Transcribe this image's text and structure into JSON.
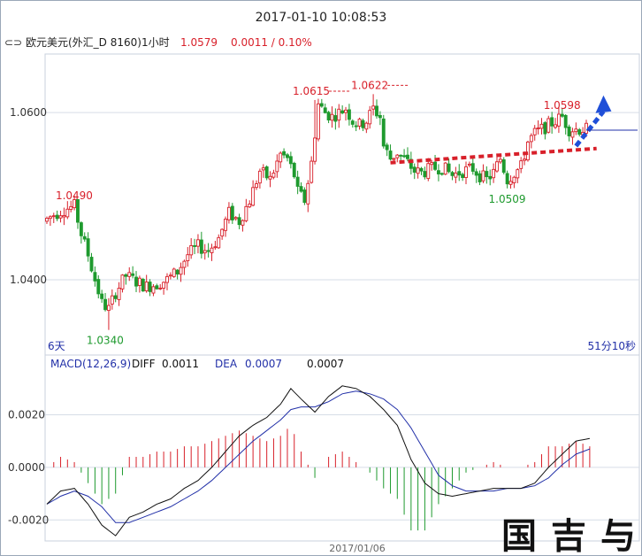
{
  "window": {
    "timestamp": "2017-01-10 10:08:53"
  },
  "header": {
    "icon": "chart-link-icon",
    "symbol": "欧元美元(外汇_D 8160)1小时",
    "last": "1.0579",
    "change": "0.0011 / 0.10%"
  },
  "price_panel": {
    "left_note": "6天",
    "right_note": "51分10秒"
  },
  "macd_panel": {
    "title": "MACD(12,26,9)",
    "diff_label": "DIFF",
    "diff_value": "0.0011",
    "dea_label": "DEA",
    "dea_value": "0.0007",
    "macd_value": "0.0007"
  },
  "x_axis": {
    "date_label": "2017/01/06"
  },
  "signature": "国吉与",
  "colors": {
    "up": "#d8202a",
    "down": "#1e9a2e",
    "dea": "#2230a8",
    "diff": "#111111",
    "arrow": "#1f4fd8",
    "trend": "#d8202a"
  },
  "chart_data": [
    {
      "type": "candlestick",
      "title": "欧元美元 1小时",
      "ylim": [
        1.031,
        1.067
      ],
      "y_ticks": [
        1.04,
        1.06
      ],
      "y_tick_labels": [
        "1.0400",
        "1.0600"
      ],
      "annotations": [
        {
          "text": "1.0490",
          "bar": 9,
          "price": 1.049,
          "kind": "high"
        },
        {
          "text": "1.0340",
          "bar": 18,
          "price": 1.034,
          "kind": "low"
        },
        {
          "text": "1.0615",
          "bar": 78,
          "price": 1.0615,
          "kind": "high"
        },
        {
          "text": "1.0622",
          "bar": 95,
          "price": 1.0622,
          "kind": "high"
        },
        {
          "text": "1.0509",
          "bar": 135,
          "price": 1.0509,
          "kind": "low"
        },
        {
          "text": "1.0598",
          "bar": 151,
          "price": 1.0598,
          "kind": "high"
        }
      ],
      "guide_points": [
        [
          0,
          1.047
        ],
        [
          3,
          1.0478
        ],
        [
          6,
          1.0484
        ],
        [
          9,
          1.0488
        ],
        [
          11,
          1.0455
        ],
        [
          13,
          1.043
        ],
        [
          15,
          1.04
        ],
        [
          17,
          1.0372
        ],
        [
          19,
          1.0365
        ],
        [
          21,
          1.0385
        ],
        [
          24,
          1.0405
        ],
        [
          27,
          1.0398
        ],
        [
          30,
          1.0392
        ],
        [
          33,
          1.0395
        ],
        [
          36,
          1.04
        ],
        [
          39,
          1.041
        ],
        [
          42,
          1.043
        ],
        [
          45,
          1.044
        ],
        [
          48,
          1.0435
        ],
        [
          51,
          1.045
        ],
        [
          54,
          1.048
        ],
        [
          57,
          1.047
        ],
        [
          60,
          1.0495
        ],
        [
          63,
          1.053
        ],
        [
          66,
          1.052
        ],
        [
          69,
          1.055
        ],
        [
          71,
          1.0545
        ],
        [
          73,
          1.0525
        ],
        [
          74,
          1.0505
        ],
        [
          76,
          1.0495
        ],
        [
          78,
          1.054
        ],
        [
          80,
          1.061
        ],
        [
          82,
          1.06
        ],
        [
          84,
          1.0595
        ],
        [
          86,
          1.06
        ],
        [
          88,
          1.0605
        ],
        [
          90,
          1.059
        ],
        [
          92,
          1.0585
        ],
        [
          94,
          1.059
        ],
        [
          96,
          1.0605
        ],
        [
          98,
          1.0595
        ],
        [
          99,
          1.056
        ],
        [
          101,
          1.0545
        ],
        [
          103,
          1.0552
        ],
        [
          106,
          1.054
        ],
        [
          108,
          1.053
        ],
        [
          110,
          1.0528
        ],
        [
          113,
          1.0533
        ],
        [
          116,
          1.0535
        ],
        [
          119,
          1.0525
        ],
        [
          122,
          1.053
        ],
        [
          125,
          1.0533
        ],
        [
          127,
          1.0525
        ],
        [
          129,
          1.052
        ],
        [
          131,
          1.0528
        ],
        [
          133,
          1.0545
        ],
        [
          135,
          1.052
        ],
        [
          137,
          1.0528
        ],
        [
          139,
          1.0535
        ],
        [
          141,
          1.0565
        ],
        [
          143,
          1.0575
        ],
        [
          145,
          1.058
        ],
        [
          147,
          1.0585
        ],
        [
          149,
          1.059
        ],
        [
          151,
          1.0595
        ],
        [
          153,
          1.058
        ]
      ],
      "extremes": [
        [
          9,
          1.049,
          "H"
        ],
        [
          18,
          1.034,
          "L"
        ],
        [
          78,
          1.0615,
          "H"
        ],
        [
          95,
          1.0622,
          "H"
        ],
        [
          135,
          1.0509,
          "L"
        ],
        [
          151,
          1.0598,
          "H"
        ]
      ],
      "trend_line": {
        "from": [
          100,
          1.054
        ],
        "to": [
          160,
          1.0557
        ]
      },
      "arrow": {
        "from": [
          154,
          1.056
        ],
        "to": [
          162,
          1.0612
        ]
      }
    },
    {
      "type": "bar",
      "title": "MACD(12,26,9)",
      "ylim": [
        -0.0028,
        0.0036
      ],
      "y_ticks": [
        -0.002,
        0.0,
        0.002
      ],
      "y_tick_labels": [
        "-0.0020",
        "0.0000",
        "0.0020"
      ],
      "diff_guide": [
        [
          0,
          -0.0014
        ],
        [
          4,
          -0.0009
        ],
        [
          8,
          -0.0008
        ],
        [
          12,
          -0.0014
        ],
        [
          16,
          -0.0022
        ],
        [
          20,
          -0.0026
        ],
        [
          24,
          -0.0019
        ],
        [
          28,
          -0.0017
        ],
        [
          32,
          -0.0014
        ],
        [
          36,
          -0.0012
        ],
        [
          40,
          -0.0008
        ],
        [
          44,
          -0.0005
        ],
        [
          48,
          0.0
        ],
        [
          52,
          0.0006
        ],
        [
          56,
          0.0012
        ],
        [
          60,
          0.0016
        ],
        [
          64,
          0.0019
        ],
        [
          68,
          0.0024
        ],
        [
          71,
          0.003
        ],
        [
          74,
          0.0026
        ],
        [
          78,
          0.0021
        ],
        [
          82,
          0.0027
        ],
        [
          86,
          0.0031
        ],
        [
          90,
          0.003
        ],
        [
          94,
          0.0027
        ],
        [
          98,
          0.0022
        ],
        [
          102,
          0.0016
        ],
        [
          106,
          0.0003
        ],
        [
          110,
          -0.0006
        ],
        [
          114,
          -0.001
        ],
        [
          118,
          -0.0011
        ],
        [
          122,
          -0.001
        ],
        [
          126,
          -0.0009
        ],
        [
          130,
          -0.0008
        ],
        [
          134,
          -0.0008
        ],
        [
          138,
          -0.0008
        ],
        [
          142,
          -0.0006
        ],
        [
          146,
          0.0
        ],
        [
          150,
          0.0005
        ],
        [
          154,
          0.001
        ],
        [
          158,
          0.0011
        ]
      ],
      "dea_guide": [
        [
          0,
          -0.0014
        ],
        [
          4,
          -0.0011
        ],
        [
          8,
          -0.0009
        ],
        [
          12,
          -0.0011
        ],
        [
          16,
          -0.0015
        ],
        [
          20,
          -0.0021
        ],
        [
          24,
          -0.0021
        ],
        [
          28,
          -0.0019
        ],
        [
          32,
          -0.0017
        ],
        [
          36,
          -0.0015
        ],
        [
          40,
          -0.0012
        ],
        [
          44,
          -0.0009
        ],
        [
          48,
          -0.0005
        ],
        [
          52,
          0.0
        ],
        [
          56,
          0.0005
        ],
        [
          60,
          0.001
        ],
        [
          64,
          0.0014
        ],
        [
          68,
          0.0018
        ],
        [
          71,
          0.0022
        ],
        [
          74,
          0.0023
        ],
        [
          78,
          0.0023
        ],
        [
          82,
          0.0025
        ],
        [
          86,
          0.0028
        ],
        [
          90,
          0.0029
        ],
        [
          94,
          0.0028
        ],
        [
          98,
          0.0026
        ],
        [
          102,
          0.0022
        ],
        [
          106,
          0.0015
        ],
        [
          110,
          0.0006
        ],
        [
          114,
          -0.0003
        ],
        [
          118,
          -0.0007
        ],
        [
          122,
          -0.0009
        ],
        [
          126,
          -0.0009
        ],
        [
          130,
          -0.0009
        ],
        [
          134,
          -0.0008
        ],
        [
          138,
          -0.0008
        ],
        [
          142,
          -0.0007
        ],
        [
          146,
          -0.0004
        ],
        [
          150,
          0.0001
        ],
        [
          154,
          0.0005
        ],
        [
          158,
          0.0007
        ]
      ]
    }
  ]
}
